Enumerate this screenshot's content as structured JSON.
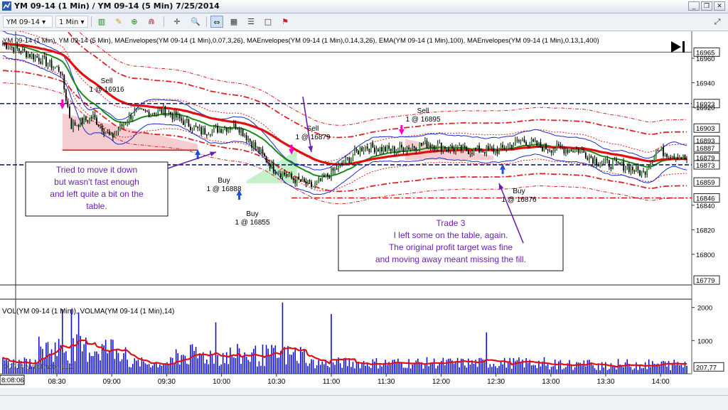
{
  "window": {
    "title": "YM 09-14 (1 Min) / YM 09-14 (5 Min)  7/25/2014",
    "minimize_glyph": "_",
    "restore_glyph": "❐",
    "close_glyph": "✕"
  },
  "toolbar": {
    "instrument": "YM 09-14",
    "interval": "1 Min",
    "icons": [
      "bar-chart-icon",
      "pencil-icon",
      "crosshair-plus-icon",
      "magnet-icon",
      "crosshair-icon",
      "zoom-in-icon",
      "zoom-out-icon",
      "grid-icon",
      "properties-icon",
      "square-icon",
      "flag-icon",
      "chart-trader-icon"
    ]
  },
  "chart": {
    "indicator_legend": "YM 09-14 (1 Min), YM 09-14 (5 Min), MAEnvelopes(YM 09-14 (1 Min),0.07,3,26), MAEnvelopes(YM 09-14 (1 Min),0.14,3,26), EMA(YM 09-14 (1 Min),100), MAEnvelopes(YM 09-14 (1 Min),0.13,1,400)",
    "volume_legend": "VOL(YM 09-14 (1 Min)), VOLMA(YM 09-14 (1 Min),14)",
    "copyright": "© 2014 NinjaTrader, LLC",
    "crosshair_time": "8:08:06",
    "price_labels": [
      {
        "text": "16965",
        "price": 16965
      },
      {
        "text": "16960",
        "price": 16960
      },
      {
        "text": "16940",
        "price": 16940
      },
      {
        "text": "16923",
        "price": 16923
      },
      {
        "text": "16920",
        "price": 16920
      },
      {
        "text": "16903",
        "price": 16903
      },
      {
        "text": "16893",
        "price": 16893
      },
      {
        "text": "16887",
        "price": 16887
      },
      {
        "text": "16879",
        "price": 16879
      },
      {
        "text": "16873",
        "price": 16873
      },
      {
        "text": "16859",
        "price": 16859
      },
      {
        "text": "16846",
        "price": 16846
      },
      {
        "text": "16840",
        "price": 16840
      },
      {
        "text": "16820",
        "price": 16820
      },
      {
        "text": "16800",
        "price": 16800
      },
      {
        "text": "16779",
        "price": 16779
      }
    ],
    "boxed_prices": [
      16965,
      16923,
      16903,
      16893,
      16887,
      16879,
      16873,
      16859,
      16846,
      16779
    ],
    "volume_labels": [
      {
        "text": "2000",
        "value": 2000
      },
      {
        "text": "1000",
        "value": 1000
      }
    ],
    "volume_boxed": {
      "text": "207,77",
      "value": 207.77
    },
    "time_labels": [
      "08:30",
      "09:00",
      "09:30",
      "10:00",
      "10:30",
      "11:00",
      "11:30",
      "12:00",
      "12:30",
      "13:00",
      "13:30",
      "14:00"
    ],
    "price_range": [
      16775,
      16982
    ],
    "volume_range": [
      0,
      2250
    ],
    "horizontal_levels": [
      16923,
      16873
    ],
    "trades": [
      {
        "label1": "Sell",
        "label2": "1 @ 16916",
        "side": "sell"
      },
      {
        "label1": "Buy",
        "label2": "1 @ 16888",
        "side": "buy"
      },
      {
        "label1": "Buy",
        "label2": "1 @ 16855",
        "side": "buy"
      },
      {
        "label1": "Sell",
        "label2": "1 @ 16879",
        "side": "sell"
      },
      {
        "label1": "Sell",
        "label2": "1 @ 16895",
        "side": "sell"
      },
      {
        "label1": "Buy",
        "label2": "1 @ 16876",
        "side": "buy"
      }
    ],
    "notes": [
      {
        "lines": [
          "Tried to move it down",
          "but wasn't fast enough",
          "and left quite a bit on the",
          "table."
        ]
      },
      {
        "lines": [
          "Trade 3",
          "I left some on the table, again.",
          "The original profit target was fine",
          "and moving away meant missing the fill."
        ]
      }
    ],
    "colors": {
      "up": "#2e8b2e",
      "down": "#000000",
      "ema": "#e01010",
      "envelope": "#e02020",
      "mid": "#1a8a1a",
      "blue": "#1a2acc",
      "level": "#101a80",
      "note": "#6a1fb3",
      "loss_fill": "#f2c4c8",
      "win_fill": "#b8f0c0",
      "sell": "#ff00cc",
      "buy": "#1f4fe0"
    }
  }
}
